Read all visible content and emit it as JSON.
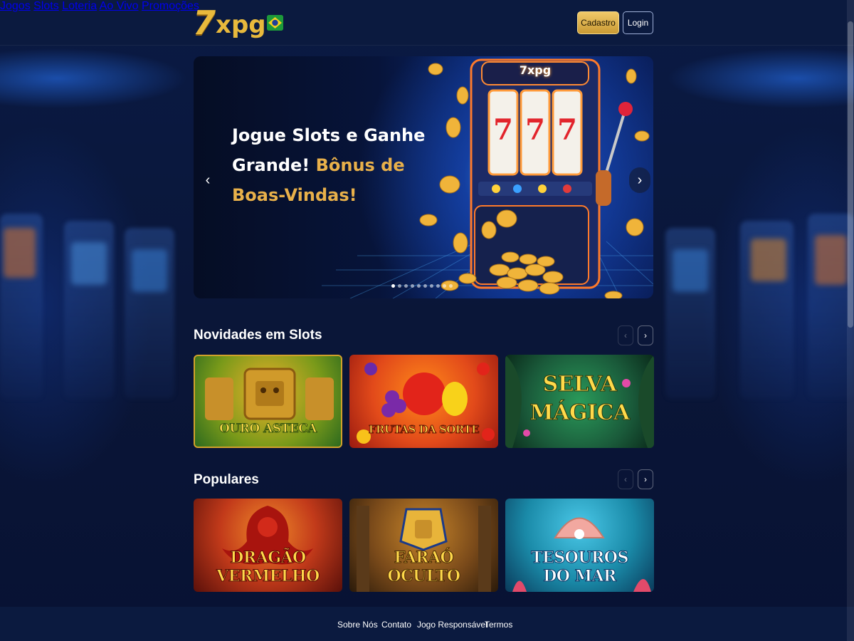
{
  "header": {
    "logo_number": "7",
    "logo_text": "xpg",
    "flag_icon": "brazil-flag-icon",
    "nav": [
      "Jogos",
      "Slots",
      "Loteria",
      "Ao Vivo",
      "Promoções"
    ],
    "signup_label": "Cadastro",
    "login_label": "Login"
  },
  "hero": {
    "title_part1": "Jogue Slots e Ganhe",
    "title_part2": "Grande!",
    "title_part3": "Bônus de",
    "title_part4": "Boas-Vindas!",
    "machine_logo": "7xpg",
    "reel_symbols": [
      "7",
      "7",
      "7"
    ],
    "slide_count": 10,
    "active_slide": 1
  },
  "sections": [
    {
      "title": "Novidades em Slots",
      "games": [
        {
          "line1": "Ouro Asteca",
          "line2": ""
        },
        {
          "line1": "Frutas da Sorte",
          "line2": ""
        },
        {
          "line1": "Selva",
          "line2": "Mágica"
        }
      ]
    },
    {
      "title": "Populares",
      "games": [
        {
          "line1": "Dragão",
          "line2": "Vermelho"
        },
        {
          "line1": "Faraó",
          "line2": "Oculto"
        },
        {
          "line1": "Tesouros",
          "line2": "do Mar"
        }
      ]
    }
  ],
  "footer": {
    "links": [
      "Sobre Nós",
      "Contato",
      "Jogo Responsável",
      "Termos"
    ]
  },
  "colors": {
    "gold": "#e8b93c",
    "header_bg": "#0b1a3f",
    "page_bg": "#0a1638"
  }
}
